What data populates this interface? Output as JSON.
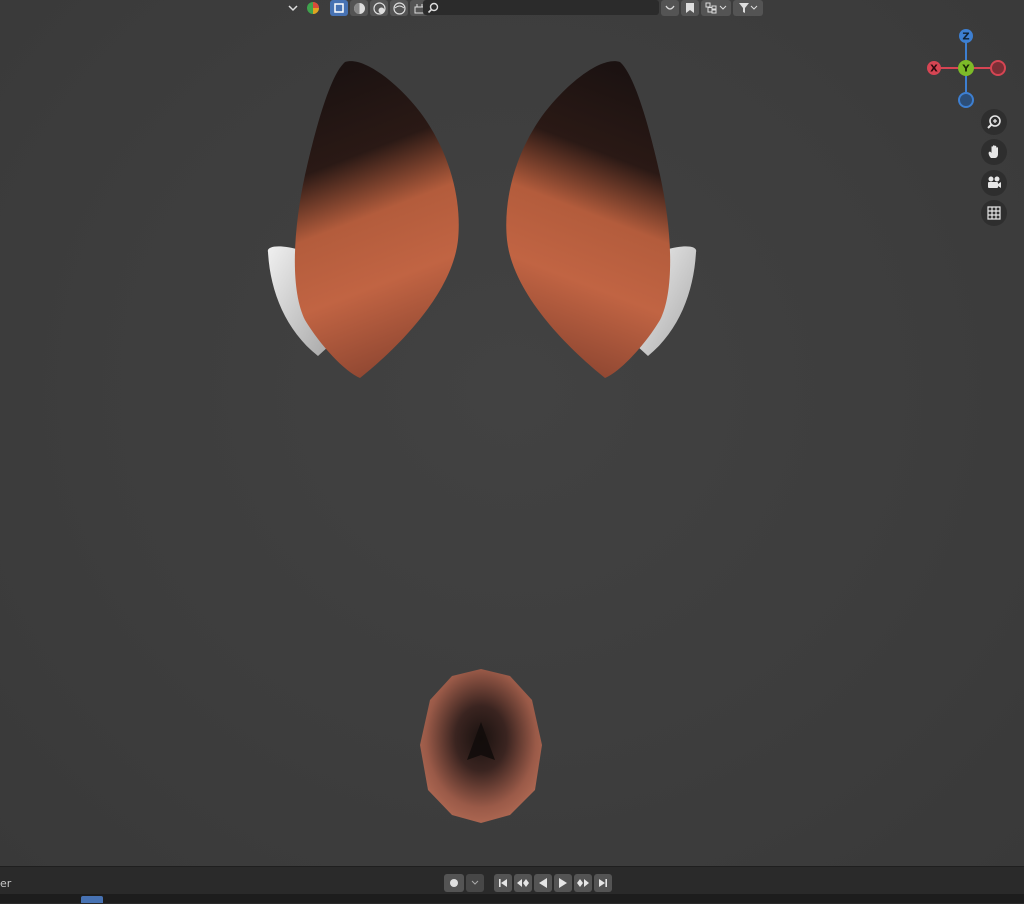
{
  "header": {
    "search": {
      "placeholder": "",
      "icon": "search-icon"
    },
    "shading_modes": [
      "wireframe",
      "solid",
      "material-preview",
      "rendered"
    ],
    "active_mode": "solid"
  },
  "gizmo": {
    "axes": {
      "x": "X",
      "y": "Y",
      "z": "Z"
    },
    "colors": {
      "x": "#d64553",
      "y": "#7dbb28",
      "z": "#3d7fd1"
    }
  },
  "nav_buttons": [
    "zoom-icon",
    "hand-icon",
    "camera-icon",
    "grid-icon"
  ],
  "timeline": {
    "label": "er"
  },
  "scene": {
    "objects": [
      "left-ear",
      "right-ear",
      "tail"
    ],
    "colors": {
      "fur": "#b85a38",
      "tip": "#1e1412",
      "inner": "#dcdcdc"
    }
  }
}
